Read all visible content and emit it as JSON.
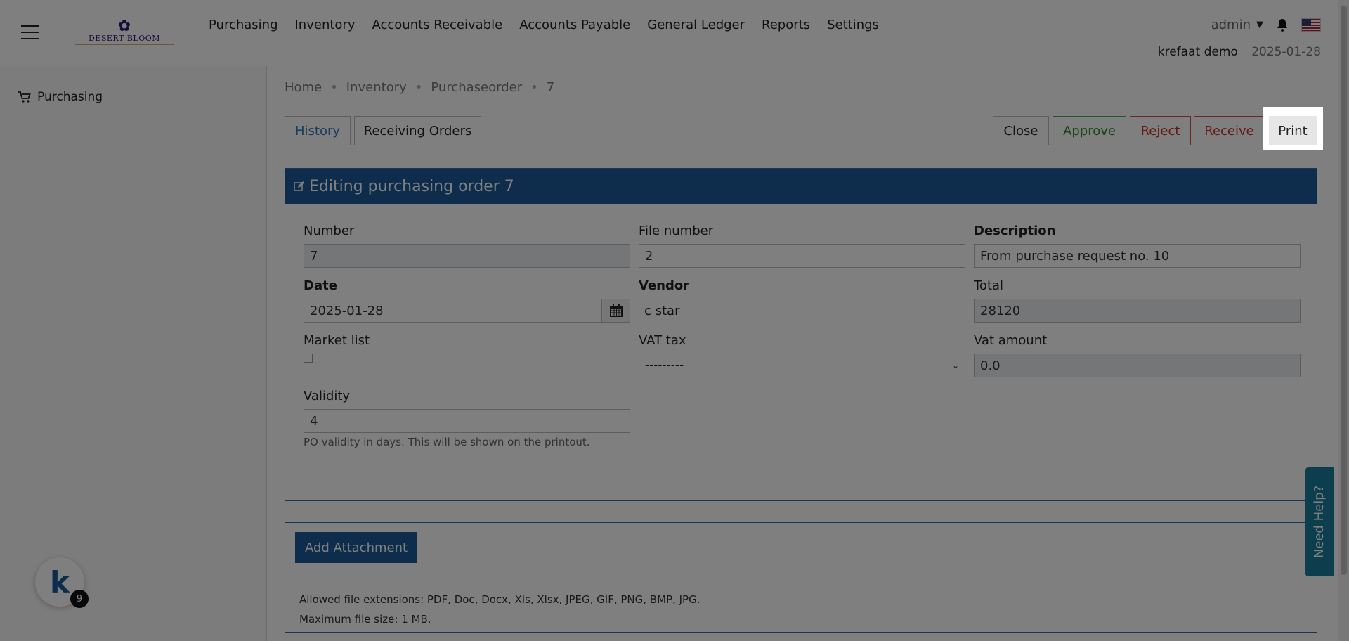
{
  "header": {
    "logo_text": "DESERT BLOOM",
    "nav": [
      "Purchasing",
      "Inventory",
      "Accounts Receivable",
      "Accounts Payable",
      "General Ledger",
      "Reports",
      "Settings"
    ],
    "user": "admin",
    "company": "krefaat demo",
    "date": "2025-01-28"
  },
  "sidebar": {
    "items": [
      {
        "label": "Purchasing",
        "icon": "cart-icon"
      }
    ]
  },
  "breadcrumb": [
    "Home",
    "Inventory",
    "Purchaseorder",
    "7"
  ],
  "toolbar": {
    "history": "History",
    "receiving_orders": "Receiving Orders",
    "close": "Close",
    "approve": "Approve",
    "reject": "Reject",
    "receive": "Receive",
    "print": "Print"
  },
  "form": {
    "title": "Editing purchasing order 7",
    "number_label": "Number",
    "number_value": "7",
    "file_number_label": "File number",
    "file_number_value": "2",
    "description_label": "Description",
    "description_value": "From purchase request no. 10",
    "date_label": "Date",
    "date_value": "2025-01-28",
    "vendor_label": "Vendor",
    "vendor_value": "c star",
    "total_label": "Total",
    "total_value": "28120",
    "market_list_label": "Market list",
    "vat_tax_label": "VAT tax",
    "vat_tax_value": "---------",
    "vat_amount_label": "Vat amount",
    "vat_amount_value": "0.0",
    "validity_label": "Validity",
    "validity_value": "4",
    "validity_help": "PO validity in days. This will be shown on the printout."
  },
  "attachments": {
    "button": "Add Attachment",
    "allowed": "Allowed file extensions: PDF, Doc, Docx, Xls, Xlsx, JPEG, GIF, PNG, BMP, JPG.",
    "max_size": "Maximum file size: 1 MB."
  },
  "help_tab": "Need Help?",
  "badge": {
    "letter": "k",
    "count": "9"
  },
  "colors": {
    "primary": "#1c5a9a",
    "approve": "#2e8b2e",
    "danger": "#c9302c"
  }
}
